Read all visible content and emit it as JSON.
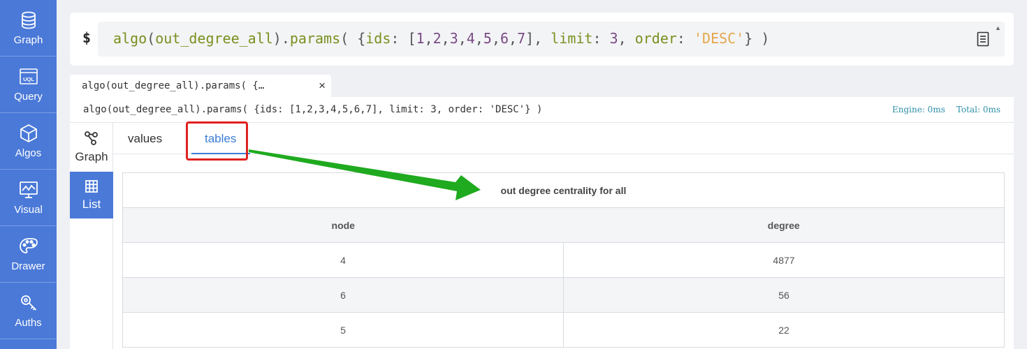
{
  "sidebar": {
    "items": [
      {
        "label": "Graph",
        "icon": "database-icon"
      },
      {
        "label": "Query",
        "icon": "uql-icon"
      },
      {
        "label": "Algos",
        "icon": "cube-icon"
      },
      {
        "label": "Visual",
        "icon": "monitor-chart-icon"
      },
      {
        "label": "Drawer",
        "icon": "palette-icon"
      },
      {
        "label": "Auths",
        "icon": "key-icon"
      }
    ]
  },
  "command": {
    "prompt": "$",
    "fn": "algo",
    "algo_name": "out_degree_all",
    "method": "params",
    "ids": [
      "1",
      "2",
      "3",
      "4",
      "5",
      "6",
      "7"
    ],
    "limit_key": "limit",
    "limit_value": "3",
    "order_key": "order",
    "order_value": "'DESC'",
    "ids_key": "ids"
  },
  "result_tab": {
    "label": "algo(out_degree_all).params( {…",
    "close": "×"
  },
  "result": {
    "query": "algo(out_degree_all).params( {ids: [1,2,3,4,5,6,7], limit: 3, order: 'DESC'} )",
    "engine": "Engine: 0ms",
    "total": "Total: 0ms"
  },
  "modes": {
    "graph": "Graph",
    "list": "List"
  },
  "subtabs": {
    "values": "values",
    "tables": "tables"
  },
  "table": {
    "caption": "out degree centrality for all",
    "columns": [
      "node",
      "degree"
    ],
    "rows": [
      [
        "4",
        "4877"
      ],
      [
        "6",
        "56"
      ],
      [
        "5",
        "22"
      ]
    ]
  },
  "colors": {
    "sidebar": "#4a79d8",
    "accent": "#3b7dd6",
    "annotation_box": "#e02020",
    "annotation_arrow": "#1faa1f"
  }
}
